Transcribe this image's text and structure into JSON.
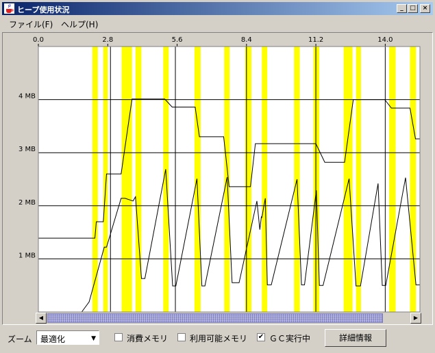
{
  "window": {
    "title": "ヒープ使用状況",
    "minimize_glyph": "_",
    "maximize_glyph": "□",
    "close_glyph": "×"
  },
  "menu": {
    "items": [
      {
        "label": "ファイル(F)"
      },
      {
        "label": "ヘルプ(H)"
      }
    ]
  },
  "scrollbar": {
    "left_arrow": "◀",
    "right_arrow": "▶"
  },
  "controls": {
    "zoom_label": "ズーム",
    "zoom_value": "最適化",
    "zoom_arrow": "▼",
    "consumed_memory": {
      "label": "消費メモリ",
      "checked": false
    },
    "available_memory": {
      "label": "利用可能メモリ",
      "checked": false
    },
    "gc_running": {
      "label": "ＧＣ実行中",
      "checked": true,
      "mark": "✔"
    },
    "detail_button": "詳細情報"
  },
  "colors": {
    "gc_band": "#ffff00",
    "line": "#000000",
    "plot_background": "#ffffff",
    "window_background": "#d4d0c8"
  },
  "chart_data": {
    "type": "line",
    "x_ticks": [
      "0.0",
      "2.8",
      "5.6",
      "8.4",
      "11.2",
      "14.0"
    ],
    "x_tick_values": [
      0,
      2.8,
      5.6,
      8.4,
      11.2,
      14.0
    ],
    "y_ticks": [
      "1 MB",
      "2 MB",
      "3 MB",
      "4 MB"
    ],
    "y_tick_values": [
      1,
      2,
      3,
      4
    ],
    "xlim": [
      0,
      15.4
    ],
    "ylim": [
      0,
      5.0
    ],
    "grid": true,
    "gc_intervals": [
      [
        2.18,
        2.4
      ],
      [
        2.62,
        2.8
      ],
      [
        3.36,
        3.78
      ],
      [
        3.92,
        4.16
      ],
      [
        5.04,
        5.26
      ],
      [
        6.3,
        6.55
      ],
      [
        7.5,
        7.72
      ],
      [
        8.34,
        8.6
      ],
      [
        9.02,
        9.24
      ],
      [
        10.32,
        10.55
      ],
      [
        11.1,
        11.34
      ],
      [
        12.32,
        12.68
      ],
      [
        12.82,
        13.02
      ],
      [
        14.16,
        14.42
      ],
      [
        15.0,
        15.24
      ]
    ],
    "markers": [
      2.91,
      5.53,
      8.4,
      11.2,
      14.0
    ],
    "series": [
      {
        "values": [
          [
            0,
            1.39
          ],
          [
            1.75,
            1.39
          ],
          [
            2.28,
            1.39
          ],
          [
            2.34,
            1.7
          ],
          [
            2.62,
            1.7
          ],
          [
            2.75,
            2.6
          ],
          [
            3.04,
            2.6
          ],
          [
            3.34,
            2.6
          ],
          [
            3.78,
            4.01
          ],
          [
            4.05,
            4.01
          ],
          [
            5.1,
            4.01
          ],
          [
            5.4,
            3.86
          ],
          [
            6.33,
            3.86
          ],
          [
            6.5,
            3.3
          ],
          [
            7.48,
            3.3
          ],
          [
            7.7,
            2.36
          ],
          [
            8.56,
            2.36
          ],
          [
            8.76,
            3.17
          ],
          [
            11.2,
            3.17
          ],
          [
            11.56,
            2.82
          ],
          [
            12.36,
            2.82
          ],
          [
            12.71,
            4.0
          ],
          [
            13.98,
            4.0
          ],
          [
            14.25,
            3.84
          ],
          [
            15.0,
            3.84
          ],
          [
            15.22,
            3.26
          ],
          [
            15.4,
            3.26
          ]
        ]
      },
      {
        "values": [
          [
            1.75,
            0.0
          ],
          [
            2.05,
            0.19
          ],
          [
            2.66,
            1.22
          ],
          [
            2.75,
            1.22
          ],
          [
            3.34,
            2.14
          ],
          [
            3.5,
            2.14
          ],
          [
            3.82,
            2.09
          ],
          [
            3.92,
            2.17
          ],
          [
            4.16,
            0.63
          ],
          [
            4.3,
            0.63
          ],
          [
            5.14,
            2.69
          ],
          [
            5.42,
            0.49
          ],
          [
            5.55,
            0.49
          ],
          [
            6.4,
            2.51
          ],
          [
            6.6,
            0.49
          ],
          [
            6.72,
            0.49
          ],
          [
            7.62,
            2.54
          ],
          [
            7.82,
            0.55
          ],
          [
            8.1,
            0.55
          ],
          [
            8.82,
            2.09
          ],
          [
            8.94,
            1.55
          ],
          [
            9.0,
            1.79
          ],
          [
            9.02,
            1.78
          ],
          [
            9.16,
            2.14
          ],
          [
            9.24,
            0.51
          ],
          [
            9.4,
            0.51
          ],
          [
            10.44,
            2.5
          ],
          [
            10.62,
            0.51
          ],
          [
            10.74,
            0.51
          ],
          [
            11.22,
            2.29
          ],
          [
            11.34,
            0.5
          ],
          [
            11.49,
            0.5
          ],
          [
            12.54,
            2.51
          ],
          [
            12.82,
            0.49
          ],
          [
            13.0,
            0.49
          ],
          [
            13.71,
            2.42
          ],
          [
            13.88,
            0.5
          ],
          [
            14.02,
            0.5
          ],
          [
            14.82,
            2.53
          ],
          [
            15.24,
            0.51
          ],
          [
            15.4,
            0.51
          ]
        ]
      }
    ]
  }
}
